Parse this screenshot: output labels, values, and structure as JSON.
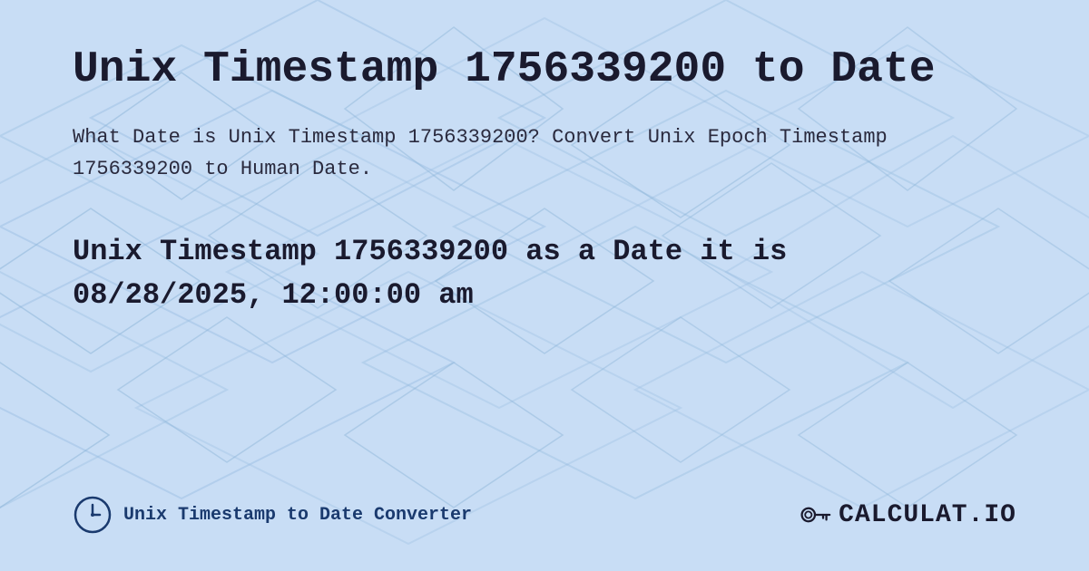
{
  "page": {
    "title": "Unix Timestamp 1756339200 to Date",
    "description": "What Date is Unix Timestamp 1756339200? Convert Unix Epoch Timestamp 1756339200 to Human Date.",
    "result_line1": "Unix Timestamp 1756339200 as a Date it is",
    "result_line2": "08/28/2025, 12:00:00 am",
    "footer_label": "Unix Timestamp to Date Converter",
    "logo_text": "CALCULAT.IO",
    "bg_color": "#c8dff5",
    "accent_color": "#1a3a6e"
  }
}
